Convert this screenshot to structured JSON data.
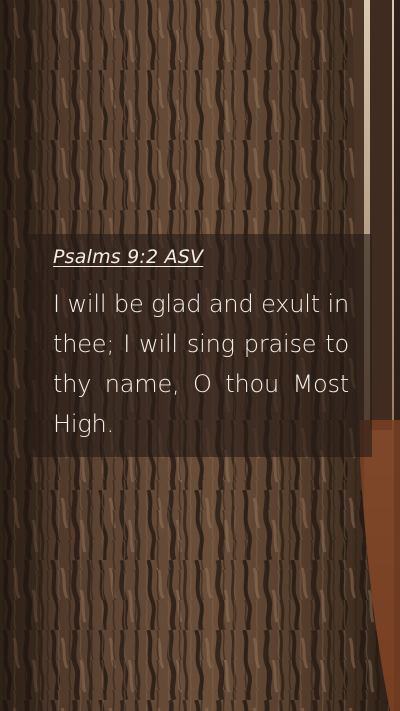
{
  "verse": {
    "reference": "Psalms 9:2 ASV",
    "text": "I will be glad and exult in thee; I will sing praise to thy name, O thou Most High."
  },
  "colors": {
    "bark_dark": "#2b1e16",
    "bark_mid": "#5a4130",
    "bark_light": "#8a6a52",
    "forest_floor": "#7a3f22",
    "overlay": "#261c16",
    "text": "#f6f0e8"
  }
}
